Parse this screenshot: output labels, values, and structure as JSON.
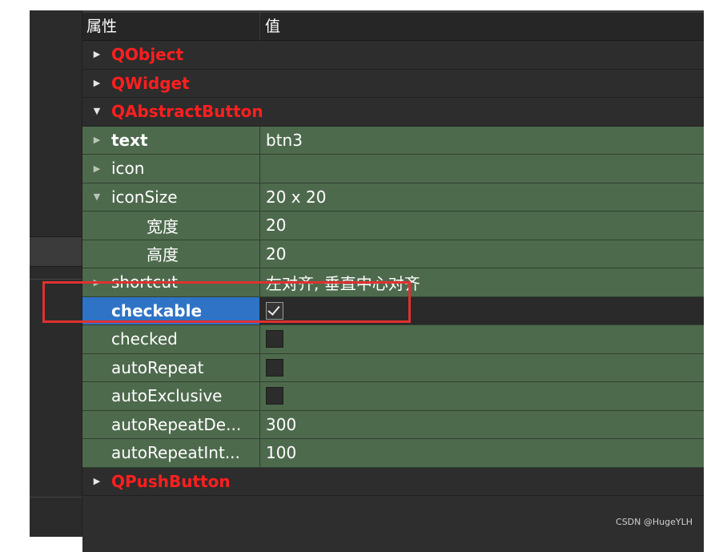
{
  "header": {
    "col_property": "属性",
    "col_value": "值"
  },
  "groups": {
    "qobject": "QObject",
    "qwidget": "QWidget",
    "qabstractbutton": "QAbstractButton",
    "qpushbutton": "QPushButton"
  },
  "properties": {
    "text": {
      "name": "text",
      "value": "btn3"
    },
    "icon": {
      "name": "icon",
      "value": ""
    },
    "iconSize": {
      "name": "iconSize",
      "value": "20 x 20"
    },
    "width": {
      "name": "宽度",
      "value": "20"
    },
    "height": {
      "name": "高度",
      "value": "20"
    },
    "shortcut": {
      "name": "shortcut",
      "value": "左对齐, 垂直中心对齐"
    },
    "checkable": {
      "name": "checkable",
      "checked": true
    },
    "checked": {
      "name": "checked",
      "checked": false
    },
    "autoRepeat": {
      "name": "autoRepeat",
      "checked": false
    },
    "autoExclusive": {
      "name": "autoExclusive",
      "checked": false
    },
    "autoRepeatDelay": {
      "name": "autoRepeatDe...",
      "value": "300"
    },
    "autoRepeatInterval": {
      "name": "autoRepeatInt...",
      "value": "100"
    }
  },
  "watermark": "CSDN @HugeYLH",
  "colors": {
    "group_label": "#ff1f1f",
    "property_row_bg": "#4e6a4d",
    "selected_bg": "#2f73c6",
    "highlight_border": "#e03131"
  }
}
